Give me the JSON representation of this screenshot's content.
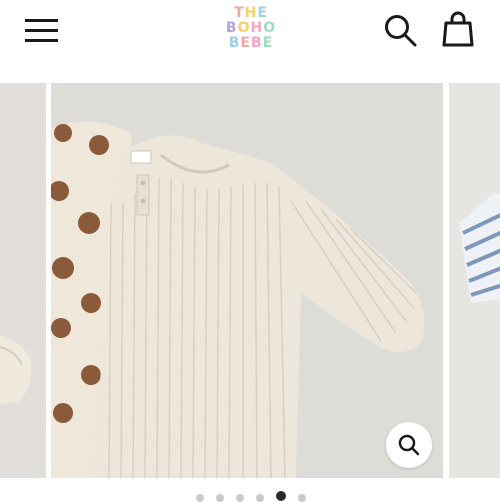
{
  "header": {
    "menu_icon": "hamburger-menu-icon",
    "logo": {
      "line1": "THE",
      "line2": "BOHO",
      "line3": "BEBE"
    },
    "search_icon": "search-icon",
    "cart_icon": "shopping-bag-icon"
  },
  "gallery": {
    "zoom_icon": "zoom-magnifier-icon",
    "slide_count": 6,
    "active_slide": 5
  },
  "colors": {
    "logo": [
      "#f5a6a0",
      "#f7cf6b",
      "#9fcfe8",
      "#b9a2dc",
      "#f2a7c6",
      "#9edcc0"
    ],
    "icon": "#1a1a1a",
    "background": "#ffffff"
  }
}
